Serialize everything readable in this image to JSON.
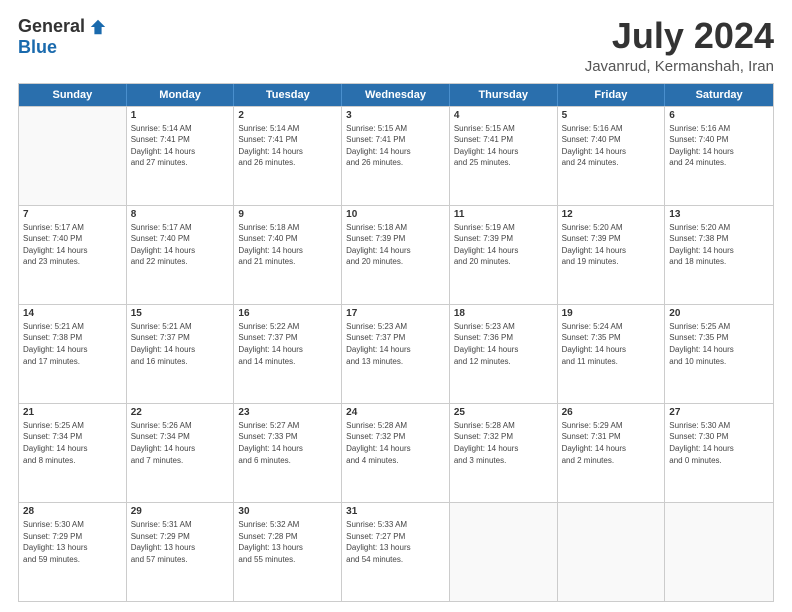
{
  "logo": {
    "general": "General",
    "blue": "Blue"
  },
  "header": {
    "month": "July 2024",
    "location": "Javanrud, Kermanshah, Iran"
  },
  "weekdays": [
    "Sunday",
    "Monday",
    "Tuesday",
    "Wednesday",
    "Thursday",
    "Friday",
    "Saturday"
  ],
  "weeks": [
    [
      {
        "day": "",
        "info": "",
        "empty": true
      },
      {
        "day": "1",
        "info": "Sunrise: 5:14 AM\nSunset: 7:41 PM\nDaylight: 14 hours\nand 27 minutes.",
        "empty": false
      },
      {
        "day": "2",
        "info": "Sunrise: 5:14 AM\nSunset: 7:41 PM\nDaylight: 14 hours\nand 26 minutes.",
        "empty": false
      },
      {
        "day": "3",
        "info": "Sunrise: 5:15 AM\nSunset: 7:41 PM\nDaylight: 14 hours\nand 26 minutes.",
        "empty": false
      },
      {
        "day": "4",
        "info": "Sunrise: 5:15 AM\nSunset: 7:41 PM\nDaylight: 14 hours\nand 25 minutes.",
        "empty": false
      },
      {
        "day": "5",
        "info": "Sunrise: 5:16 AM\nSunset: 7:40 PM\nDaylight: 14 hours\nand 24 minutes.",
        "empty": false
      },
      {
        "day": "6",
        "info": "Sunrise: 5:16 AM\nSunset: 7:40 PM\nDaylight: 14 hours\nand 24 minutes.",
        "empty": false
      }
    ],
    [
      {
        "day": "7",
        "info": "Sunrise: 5:17 AM\nSunset: 7:40 PM\nDaylight: 14 hours\nand 23 minutes.",
        "empty": false
      },
      {
        "day": "8",
        "info": "Sunrise: 5:17 AM\nSunset: 7:40 PM\nDaylight: 14 hours\nand 22 minutes.",
        "empty": false
      },
      {
        "day": "9",
        "info": "Sunrise: 5:18 AM\nSunset: 7:40 PM\nDaylight: 14 hours\nand 21 minutes.",
        "empty": false
      },
      {
        "day": "10",
        "info": "Sunrise: 5:18 AM\nSunset: 7:39 PM\nDaylight: 14 hours\nand 20 minutes.",
        "empty": false
      },
      {
        "day": "11",
        "info": "Sunrise: 5:19 AM\nSunset: 7:39 PM\nDaylight: 14 hours\nand 20 minutes.",
        "empty": false
      },
      {
        "day": "12",
        "info": "Sunrise: 5:20 AM\nSunset: 7:39 PM\nDaylight: 14 hours\nand 19 minutes.",
        "empty": false
      },
      {
        "day": "13",
        "info": "Sunrise: 5:20 AM\nSunset: 7:38 PM\nDaylight: 14 hours\nand 18 minutes.",
        "empty": false
      }
    ],
    [
      {
        "day": "14",
        "info": "Sunrise: 5:21 AM\nSunset: 7:38 PM\nDaylight: 14 hours\nand 17 minutes.",
        "empty": false
      },
      {
        "day": "15",
        "info": "Sunrise: 5:21 AM\nSunset: 7:37 PM\nDaylight: 14 hours\nand 16 minutes.",
        "empty": false
      },
      {
        "day": "16",
        "info": "Sunrise: 5:22 AM\nSunset: 7:37 PM\nDaylight: 14 hours\nand 14 minutes.",
        "empty": false
      },
      {
        "day": "17",
        "info": "Sunrise: 5:23 AM\nSunset: 7:37 PM\nDaylight: 14 hours\nand 13 minutes.",
        "empty": false
      },
      {
        "day": "18",
        "info": "Sunrise: 5:23 AM\nSunset: 7:36 PM\nDaylight: 14 hours\nand 12 minutes.",
        "empty": false
      },
      {
        "day": "19",
        "info": "Sunrise: 5:24 AM\nSunset: 7:35 PM\nDaylight: 14 hours\nand 11 minutes.",
        "empty": false
      },
      {
        "day": "20",
        "info": "Sunrise: 5:25 AM\nSunset: 7:35 PM\nDaylight: 14 hours\nand 10 minutes.",
        "empty": false
      }
    ],
    [
      {
        "day": "21",
        "info": "Sunrise: 5:25 AM\nSunset: 7:34 PM\nDaylight: 14 hours\nand 8 minutes.",
        "empty": false
      },
      {
        "day": "22",
        "info": "Sunrise: 5:26 AM\nSunset: 7:34 PM\nDaylight: 14 hours\nand 7 minutes.",
        "empty": false
      },
      {
        "day": "23",
        "info": "Sunrise: 5:27 AM\nSunset: 7:33 PM\nDaylight: 14 hours\nand 6 minutes.",
        "empty": false
      },
      {
        "day": "24",
        "info": "Sunrise: 5:28 AM\nSunset: 7:32 PM\nDaylight: 14 hours\nand 4 minutes.",
        "empty": false
      },
      {
        "day": "25",
        "info": "Sunrise: 5:28 AM\nSunset: 7:32 PM\nDaylight: 14 hours\nand 3 minutes.",
        "empty": false
      },
      {
        "day": "26",
        "info": "Sunrise: 5:29 AM\nSunset: 7:31 PM\nDaylight: 14 hours\nand 2 minutes.",
        "empty": false
      },
      {
        "day": "27",
        "info": "Sunrise: 5:30 AM\nSunset: 7:30 PM\nDaylight: 14 hours\nand 0 minutes.",
        "empty": false
      }
    ],
    [
      {
        "day": "28",
        "info": "Sunrise: 5:30 AM\nSunset: 7:29 PM\nDaylight: 13 hours\nand 59 minutes.",
        "empty": false
      },
      {
        "day": "29",
        "info": "Sunrise: 5:31 AM\nSunset: 7:29 PM\nDaylight: 13 hours\nand 57 minutes.",
        "empty": false
      },
      {
        "day": "30",
        "info": "Sunrise: 5:32 AM\nSunset: 7:28 PM\nDaylight: 13 hours\nand 55 minutes.",
        "empty": false
      },
      {
        "day": "31",
        "info": "Sunrise: 5:33 AM\nSunset: 7:27 PM\nDaylight: 13 hours\nand 54 minutes.",
        "empty": false
      },
      {
        "day": "",
        "info": "",
        "empty": true
      },
      {
        "day": "",
        "info": "",
        "empty": true
      },
      {
        "day": "",
        "info": "",
        "empty": true
      }
    ]
  ]
}
